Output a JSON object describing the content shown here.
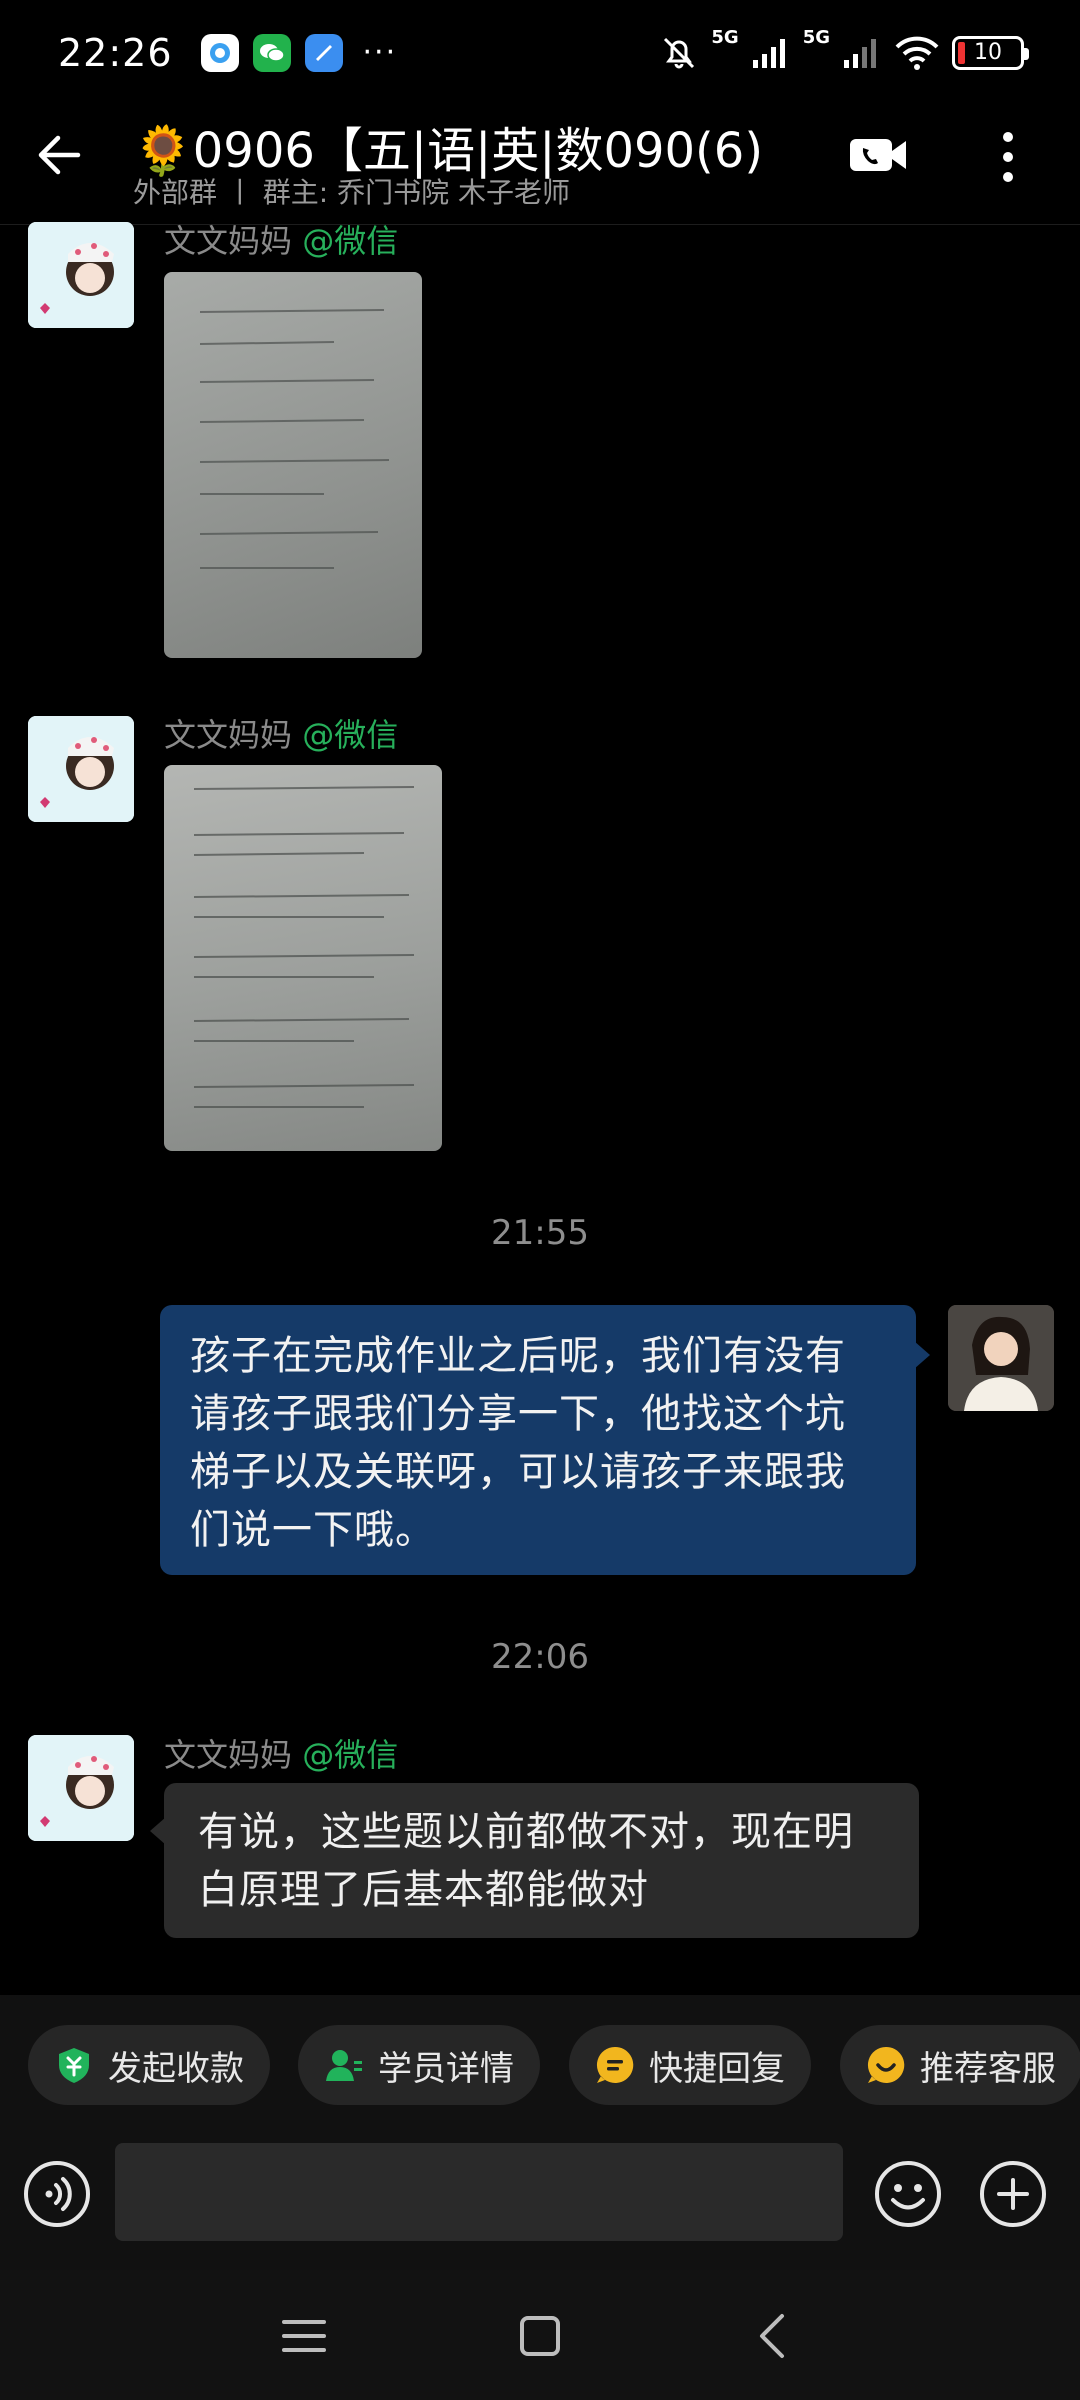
{
  "status_bar": {
    "time": "22:26",
    "net1": "5G",
    "net2": "5G",
    "battery": "10",
    "more": "···"
  },
  "header": {
    "title": "🌻0906【五|语|英|数090(6)",
    "subtitle": "外部群 丨 群主: 乔门书院 木子老师"
  },
  "messages": [
    {
      "sender": "文文妈妈",
      "source": "@微信",
      "type": "image"
    },
    {
      "sender": "文文妈妈",
      "source": "@微信",
      "type": "image"
    },
    {
      "timestamp": "21:55"
    },
    {
      "type": "outgoing",
      "text": "孩子在完成作业之后呢，我们有没有请孩子跟我们分享一下，他找这个坑梯子以及关联呀，可以请孩子来跟我们说一下哦。"
    },
    {
      "timestamp": "22:06"
    },
    {
      "sender": "文文妈妈",
      "source": "@微信",
      "type": "text",
      "text": "有说，这些题以前都做不对，现在明白原理了后基本都能做对"
    }
  ],
  "quick_actions": [
    {
      "label": "发起收款",
      "icon": "payment-shield-icon",
      "color": "#21b35b"
    },
    {
      "label": "学员详情",
      "icon": "student-icon",
      "color": "#21b35b"
    },
    {
      "label": "快捷回复",
      "icon": "quick-reply-icon",
      "color": "#f2b61e"
    },
    {
      "label": "推荐客服",
      "icon": "service-icon",
      "color": "#f2b61e"
    }
  ],
  "colors": {
    "outgoing_bubble": "#153a68",
    "incoming_bubble": "#2b2b2b",
    "source_green": "#27b05b"
  }
}
